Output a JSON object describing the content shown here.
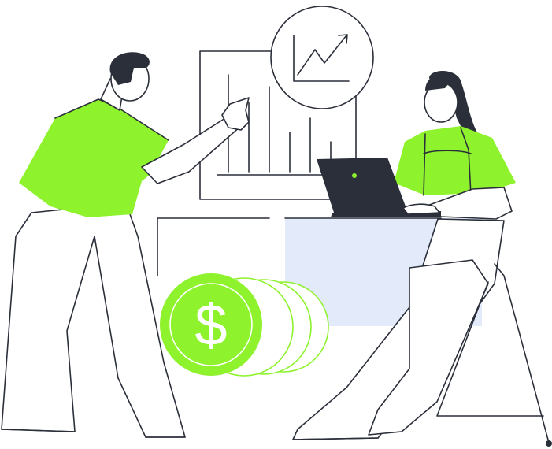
{
  "illustration": {
    "currency_symbol": "$",
    "colors": {
      "accent": "#8ef22d",
      "ink": "#2b2f3a",
      "panel": "#e3ebfb",
      "background": "#ffffff"
    },
    "icons": [
      "trend-up-icon",
      "dollar-coin-icon",
      "laptop-icon"
    ]
  }
}
